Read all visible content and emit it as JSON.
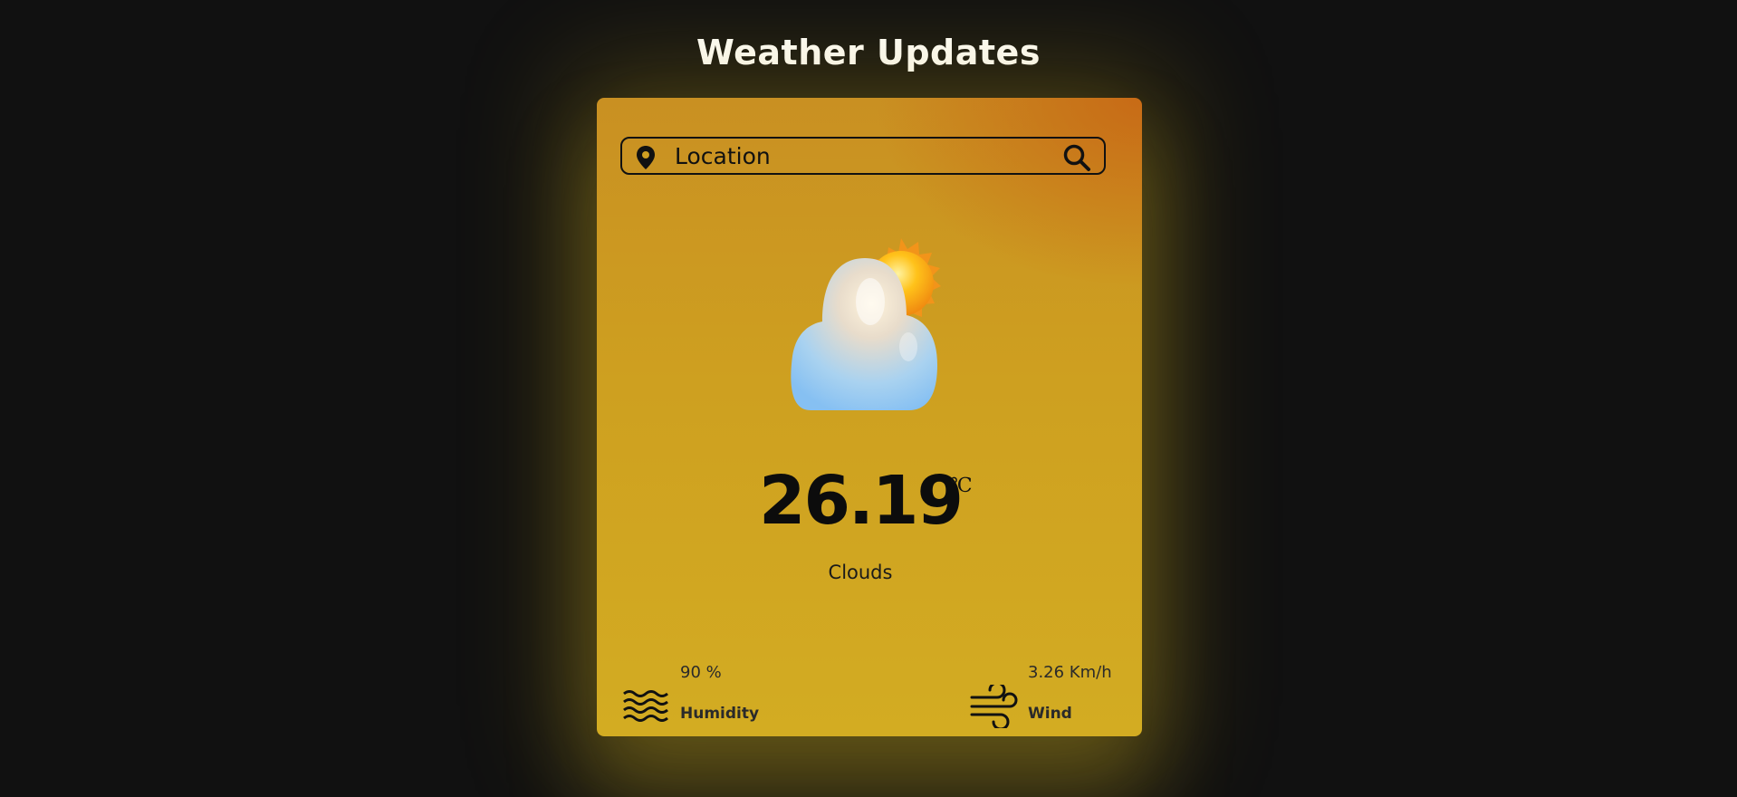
{
  "page": {
    "title": "Weather Updates"
  },
  "search": {
    "placeholder": "Location",
    "pin_icon": "location-pin-icon",
    "search_icon": "magnifier-icon"
  },
  "weather": {
    "icon": "cloud-sun-icon",
    "temperature": "26.19",
    "unit": "℃",
    "condition": "Clouds"
  },
  "details": {
    "humidity": {
      "icon": "water-waves-icon",
      "value": "90 %",
      "label": "Humidity"
    },
    "wind": {
      "icon": "wind-icon",
      "value": "3.26 Km/h",
      "label": "Wind"
    }
  },
  "colors": {
    "background": "#111111",
    "card_top_right": "#c8641a",
    "card_base": "#d3ac22",
    "text_dark": "#111111",
    "title_text": "#ffffff"
  }
}
